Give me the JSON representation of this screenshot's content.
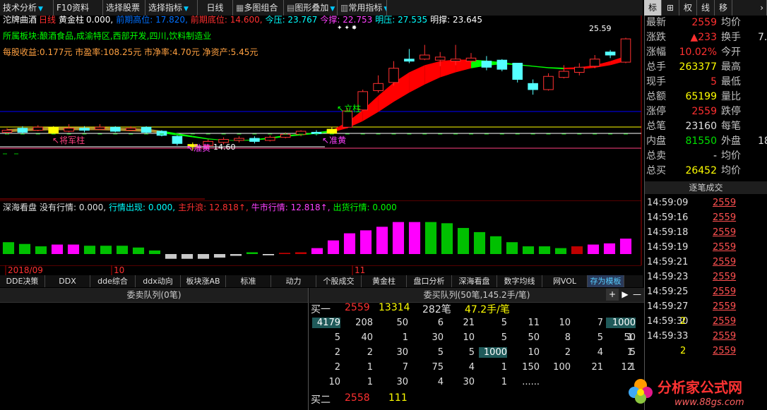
{
  "toolbar": {
    "items": [
      "技术分析",
      "F10资料",
      "选择股票",
      "选择指标",
      "日线",
      "多图组合",
      "图形叠加",
      "常用指标"
    ],
    "right_items": [
      "标",
      "⊞",
      "权",
      "线",
      "移"
    ]
  },
  "main_header": {
    "stock_name": "沱牌曲酒",
    "period": "日线",
    "indicator": "黄金柱",
    "indicator_value": "0.000,",
    "seg_a": "前期高位: 17.820,",
    "seg_b": "前期底位: 14.600,",
    "seg_c": "今压: 23.767",
    "seg_d": "今撑: 22.753",
    "seg_e": "明压: 27.535",
    "seg_f": "明撑: 23.645",
    "sector": "所属板块:酿酒食品,成渝特区,西部开发,四川,饮料制造业",
    "finance": "每股收益:0.177元 市盈率:108.25元 市净率:4.70元 净资产:5.45元",
    "price_label": "25.59",
    "low_label": "14.60",
    "annotations": {
      "jiangjun": "将军柱",
      "zhunhuang1": "准黄",
      "zhunhuang2": "准黄",
      "lizhu": "立柱"
    }
  },
  "sub_header": {
    "name": "深海看盘",
    "s1": "没有行情: 0.000,",
    "s2": "行情出现: 0.000,",
    "s3": "主升浪: 12.818↑,",
    "s4": "牛市行情: 12.818↑,",
    "s5": "出货行情: 0.000"
  },
  "chart_data": {
    "type": "bar",
    "candles": [
      {
        "o": 16.4,
        "c": 16.6,
        "h": 16.8,
        "l": 16.2,
        "up": true
      },
      {
        "o": 16.8,
        "c": 16.4,
        "h": 17.0,
        "l": 16.2,
        "up": false
      },
      {
        "o": 16.6,
        "c": 16.9,
        "h": 17.1,
        "l": 16.5,
        "up": true
      },
      {
        "o": 16.9,
        "c": 16.3,
        "h": 17.0,
        "l": 16.2,
        "up": false,
        "yellow": true
      },
      {
        "o": 16.5,
        "c": 16.8,
        "h": 17.2,
        "l": 16.4,
        "up": true
      },
      {
        "o": 16.8,
        "c": 16.6,
        "h": 17.0,
        "l": 16.4,
        "up": false
      },
      {
        "o": 16.7,
        "c": 16.9,
        "h": 17.2,
        "l": 16.6,
        "up": true
      },
      {
        "o": 16.9,
        "c": 16.5,
        "h": 17.0,
        "l": 16.4,
        "up": false
      },
      {
        "o": 16.6,
        "c": 16.8,
        "h": 17.0,
        "l": 16.5,
        "up": true
      },
      {
        "o": 16.9,
        "c": 16.4,
        "h": 17.0,
        "l": 16.3,
        "up": false
      },
      {
        "o": 16.5,
        "c": 16.1,
        "h": 16.6,
        "l": 16.0,
        "up": false
      },
      {
        "o": 16.0,
        "c": 15.3,
        "h": 16.1,
        "l": 15.1,
        "up": false
      },
      {
        "o": 15.2,
        "c": 15.0,
        "h": 15.4,
        "l": 14.6,
        "up": false,
        "yellow": true
      },
      {
        "o": 15.1,
        "c": 15.5,
        "h": 15.7,
        "l": 14.9,
        "up": true
      },
      {
        "o": 15.4,
        "c": 15.7,
        "h": 15.9,
        "l": 15.2,
        "up": true
      },
      {
        "o": 15.6,
        "c": 15.8,
        "h": 16.0,
        "l": 15.4,
        "up": true
      },
      {
        "o": 15.8,
        "c": 15.5,
        "h": 16.0,
        "l": 15.3,
        "up": false
      },
      {
        "o": 15.6,
        "c": 15.9,
        "h": 16.1,
        "l": 15.5,
        "up": true
      },
      {
        "o": 15.9,
        "c": 16.2,
        "h": 16.4,
        "l": 15.8,
        "up": true
      },
      {
        "o": 16.2,
        "c": 16.5,
        "h": 16.6,
        "l": 16.0,
        "up": true
      },
      {
        "o": 16.4,
        "c": 16.3,
        "h": 16.6,
        "l": 16.1,
        "up": false
      },
      {
        "o": 16.3,
        "c": 16.7,
        "h": 16.9,
        "l": 16.2,
        "up": true,
        "yellow": true
      },
      {
        "o": 16.9,
        "c": 18.5,
        "h": 18.8,
        "l": 16.8,
        "up": true
      },
      {
        "o": 18.6,
        "c": 20.4,
        "h": 20.6,
        "l": 18.5,
        "up": true
      },
      {
        "o": 20.5,
        "c": 21.2,
        "h": 22.0,
        "l": 20.3,
        "up": true
      },
      {
        "o": 21.3,
        "c": 22.7,
        "h": 23.4,
        "l": 21.0,
        "up": true
      },
      {
        "o": 23.6,
        "c": 23.4,
        "h": 24.6,
        "l": 23.2,
        "up": false
      },
      {
        "o": 23.6,
        "c": 24.0,
        "h": 25.0,
        "l": 23.5,
        "up": true
      },
      {
        "o": 23.8,
        "c": 23.5,
        "h": 24.3,
        "l": 22.9,
        "up": true
      },
      {
        "o": 23.4,
        "c": 23.6,
        "h": 25.0,
        "l": 23.0,
        "up": true
      },
      {
        "o": 23.7,
        "c": 23.4,
        "h": 24.2,
        "l": 23.2,
        "up": true
      },
      {
        "o": 23.4,
        "c": 22.8,
        "h": 23.9,
        "l": 22.5,
        "up": false
      },
      {
        "o": 23.5,
        "c": 22.6,
        "h": 23.6,
        "l": 22.4,
        "up": false
      },
      {
        "o": 23.2,
        "c": 21.6,
        "h": 23.2,
        "l": 21.3,
        "up": false
      },
      {
        "o": 21.2,
        "c": 20.6,
        "h": 21.6,
        "l": 20.1,
        "up": false
      },
      {
        "o": 20.6,
        "c": 21.9,
        "h": 22.2,
        "l": 20.5,
        "up": true
      },
      {
        "o": 21.8,
        "c": 22.4,
        "h": 23.0,
        "l": 21.7,
        "up": true
      },
      {
        "o": 22.3,
        "c": 22.8,
        "h": 23.2,
        "l": 22.0,
        "up": true
      },
      {
        "o": 22.9,
        "c": 23.6,
        "h": 24.0,
        "l": 22.7,
        "up": true
      },
      {
        "o": 24.0,
        "c": 24.3,
        "h": 24.5,
        "l": 23.7,
        "up": false
      },
      {
        "o": 23.3,
        "c": 25.59,
        "h": 25.7,
        "l": 23.2,
        "up": true
      }
    ],
    "sub_bars": [
      {
        "v": 2.0,
        "c": "green"
      },
      {
        "v": 1.7,
        "c": "green"
      },
      {
        "v": 1.3,
        "c": "green"
      },
      {
        "v": 1.6,
        "c": "magenta"
      },
      {
        "v": 1.6,
        "c": "magenta"
      },
      {
        "v": 1.4,
        "c": "green"
      },
      {
        "v": 1.4,
        "c": "green"
      },
      {
        "v": 1.4,
        "c": "green"
      },
      {
        "v": 1.1,
        "c": "green"
      },
      {
        "v": 0.6,
        "c": "green"
      },
      {
        "v": -0.8,
        "c": "gray"
      },
      {
        "v": -0.8,
        "c": "gray"
      },
      {
        "v": -0.8,
        "c": "gray"
      },
      {
        "v": -0.6,
        "c": "gray"
      },
      {
        "v": -0.3,
        "c": "gray"
      },
      {
        "v": 0.3,
        "c": "green"
      },
      {
        "v": -0.2,
        "c": "white"
      },
      {
        "v": 0.2,
        "c": "red"
      },
      {
        "v": 0.3,
        "c": "red"
      },
      {
        "v": 1.0,
        "c": "magenta"
      },
      {
        "v": 2.3,
        "c": "magenta"
      },
      {
        "v": 3.5,
        "c": "magenta"
      },
      {
        "v": 4.0,
        "c": "magenta"
      },
      {
        "v": 4.6,
        "c": "magenta"
      },
      {
        "v": 5.4,
        "c": "magenta"
      },
      {
        "v": 5.4,
        "c": "magenta"
      },
      {
        "v": 5.4,
        "c": "green"
      },
      {
        "v": 5.2,
        "c": "green"
      },
      {
        "v": 4.4,
        "c": "green"
      },
      {
        "v": 3.7,
        "c": "green"
      },
      {
        "v": 3.0,
        "c": "green"
      },
      {
        "v": 2.0,
        "c": "green"
      },
      {
        "v": 1.3,
        "c": "green"
      },
      {
        "v": 1.3,
        "c": "green"
      },
      {
        "v": 1.0,
        "c": "green"
      },
      {
        "v": 1.3,
        "c": "red"
      },
      {
        "v": 1.6,
        "c": "magenta"
      },
      {
        "v": 1.8,
        "c": "magenta"
      },
      {
        "v": 2.6,
        "c": "magenta"
      }
    ],
    "months": [
      "2018/09",
      "10",
      "11"
    ],
    "ribbon_green_top": "#00ff00",
    "ribbon_red_top": "#ff0000"
  },
  "indicator_tabs": [
    "DDE决策",
    "DDX",
    "dde综合",
    "ddx动向",
    "板块涨AB",
    "标准",
    "动力",
    "个股成交",
    "黄金柱",
    "盘口分析",
    "深海看盘",
    "数字均线",
    "网VOL",
    "存为模板"
  ],
  "sell_queue": {
    "title": "委卖队列(0笔)"
  },
  "buy_queue": {
    "title": "委买队列(50笔,145.2手/笔)",
    "buy1_label": "买一",
    "buy1_price": "2559",
    "buy1_vol": "13314",
    "buy1_count": "282笔",
    "buy1_avg": "47.2手/笔",
    "rows": [
      [
        "4179",
        "208",
        "50",
        "6",
        "21",
        "5",
        "11",
        "10",
        "7",
        "44",
        "1000"
      ],
      [
        "5",
        "40",
        "1",
        "30",
        "10",
        "5",
        "50",
        "8",
        "5",
        "1",
        "50"
      ],
      [
        "2",
        "2",
        "30",
        "5",
        "5",
        "1000",
        "10",
        "2",
        "4",
        "1",
        "5"
      ],
      [
        "2",
        "1",
        "7",
        "75",
        "4",
        "1",
        "150",
        "100",
        "21",
        "12",
        "1"
      ],
      [
        "10",
        "1",
        "30",
        "4",
        "30",
        "1",
        "......",
        "",
        "",
        "",
        ""
      ]
    ],
    "buy2_label": "买二",
    "buy2_price": "2558",
    "buy2_vol": "111"
  },
  "quote": {
    "rows": [
      {
        "l1": "最新",
        "v1": "2559",
        "c1": "red",
        "l2": "均价",
        "v2": ""
      },
      {
        "l1": "涨跌",
        "v1": "▲233",
        "c1": "red",
        "l2": "换手",
        "v2": "7."
      },
      {
        "l1": "涨幅",
        "v1": "10.02%",
        "c1": "red",
        "l2": "今开",
        "v2": ""
      },
      {
        "l1": "总手",
        "v1": "263377",
        "c1": "yellow",
        "l2": "最高",
        "v2": ""
      },
      {
        "l1": "现手",
        "v1": "5",
        "c1": "red",
        "l2": "最低",
        "v2": ""
      },
      {
        "l1": "总额",
        "v1": "65199",
        "c1": "yellow",
        "l2": "量比",
        "v2": ""
      },
      {
        "l1": "涨停",
        "v1": "2559",
        "c1": "red",
        "l2": "跌停",
        "v2": ""
      },
      {
        "l1": "总笔",
        "v1": "23160",
        "c1": "white",
        "l2": "每笔",
        "v2": ""
      },
      {
        "l1": "内盘",
        "v1": "81550",
        "c1": "green",
        "l2": "外盘",
        "v2": "181"
      },
      {
        "l1": "总卖",
        "v1": "-",
        "c1": "white",
        "l2": "均价",
        "v2": ""
      },
      {
        "l1": "总买",
        "v1": "26452",
        "c1": "yellow",
        "l2": "均价",
        "v2": ""
      }
    ]
  },
  "ticks": {
    "title": "逐笔成交",
    "rows": [
      {
        "t": "14:59:09",
        "p": "2559"
      },
      {
        "t": "14:59:16",
        "p": "2559"
      },
      {
        "t": "14:59:18",
        "p": "2559"
      },
      {
        "t": "14:59:19",
        "p": "2559"
      },
      {
        "t": "14:59:21",
        "p": "2559"
      },
      {
        "t": "14:59:23",
        "p": "2559"
      },
      {
        "t": "14:59:25",
        "p": "2559"
      },
      {
        "t": "14:59:27",
        "p": "2559"
      },
      {
        "t": "14:59:30",
        "p": "2559",
        "v": "2"
      },
      {
        "t": "14:59:33",
        "p": "2559"
      },
      {
        "t": "",
        "p": "2559",
        "v": "2"
      }
    ]
  },
  "watermark": {
    "cn": "分析家公式网",
    "url": "www.88gs.com"
  }
}
